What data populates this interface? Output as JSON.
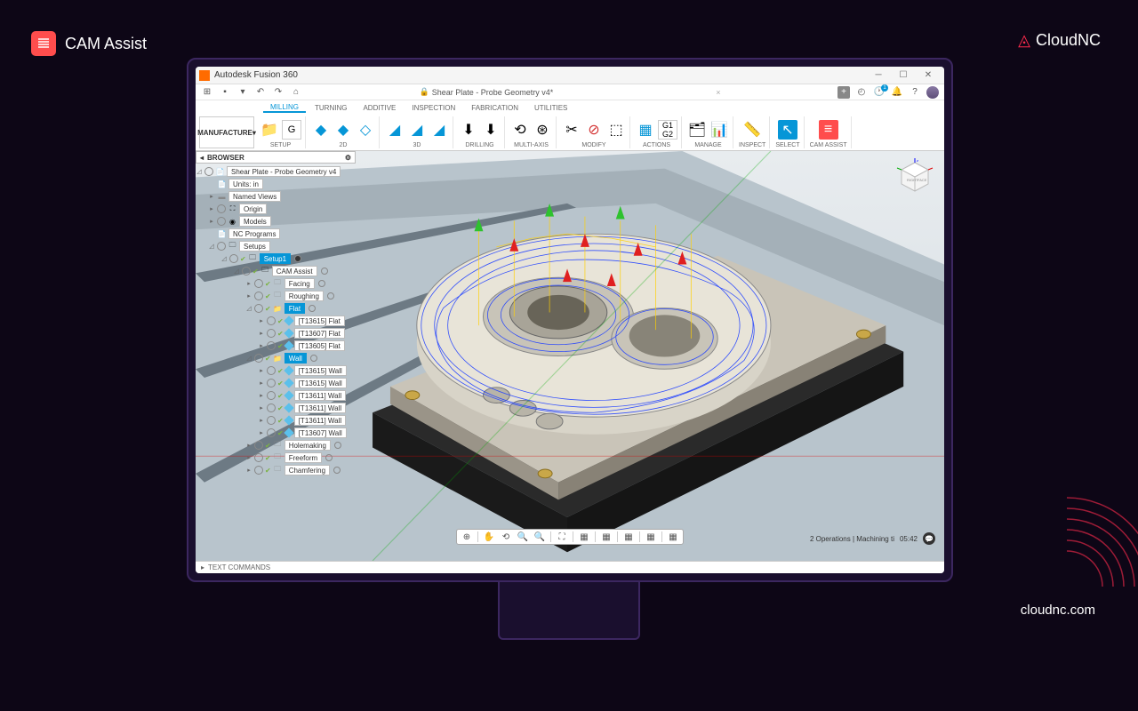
{
  "branding": {
    "app_name": "CAM Assist",
    "company": "CloudNC",
    "website": "cloudnc.com"
  },
  "window": {
    "title": "Autodesk Fusion 360",
    "document": "Shear Plate - Probe Geometry v4*"
  },
  "ribbon": {
    "workspace": "MANUFACTURE",
    "tabs": [
      "MILLING",
      "TURNING",
      "ADDITIVE",
      "INSPECTION",
      "FABRICATION",
      "UTILITIES"
    ],
    "active_tab": "MILLING",
    "groups": {
      "setup": "SETUP",
      "two_d": "2D",
      "three_d": "3D",
      "drilling": "DRILLING",
      "multi_axis": "MULTI-AXIS",
      "modify": "MODIFY",
      "actions": "ACTIONS",
      "manage": "MANAGE",
      "inspect": "INSPECT",
      "select": "SELECT",
      "cam_assist": "CAM ASSIST"
    }
  },
  "browser": {
    "title": "BROWSER",
    "root": "Shear Plate - Probe Geometry v4",
    "nodes": {
      "units": "Units: in",
      "named_views": "Named Views",
      "origin": "Origin",
      "models": "Models",
      "nc_programs": "NC Programs",
      "setups": "Setups",
      "setup1": "Setup1",
      "cam_assist": "CAM Assist",
      "facing": "Facing",
      "roughing": "Roughing",
      "flat": "Flat",
      "flat_ops": [
        "[T13615] Flat",
        "[T13607] Flat",
        "[T13605] Flat"
      ],
      "wall": "Wall",
      "wall_ops": [
        "[T13615] Wall",
        "[T13615] Wall",
        "[T13611] Wall",
        "[T13611] Wall",
        "[T13611] Wall",
        "[T13607] Wall"
      ],
      "holemaking": "Holemaking",
      "freeform": "Freeform",
      "chamfering": "Chamfering"
    }
  },
  "status": {
    "text": "2 Operations | Machining ti",
    "extra": "05:42"
  },
  "text_commands": "TEXT COMMANDS",
  "qat": {
    "clock_badge": "1"
  }
}
